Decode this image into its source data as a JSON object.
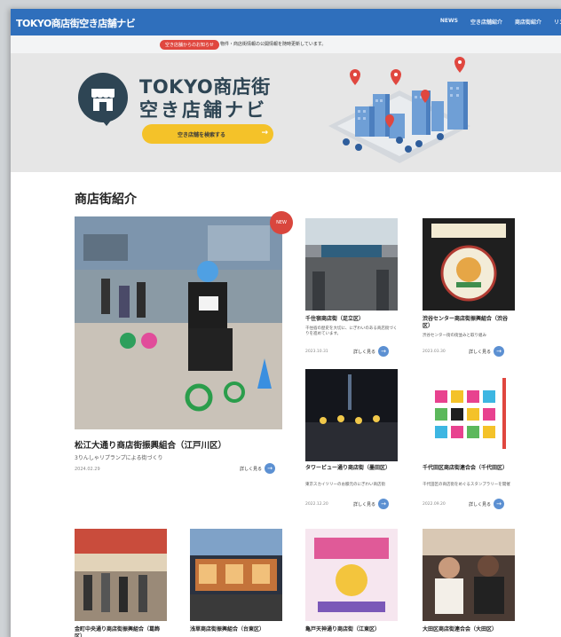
{
  "header": {
    "logo": "TOKYO商店街空き店舗ナビ",
    "nav": [
      "NEWS",
      "空き店舗紹介",
      "商店街紹介",
      "リン"
    ]
  },
  "notice": {
    "badge": "空き店舗からのお知らせ",
    "text": "物件・商店街情報の公開情報を随時更新しています。"
  },
  "hero": {
    "title_line1": "TOKYO商店街",
    "title_line2": "空き店舗ナビ",
    "button_label": "空き店舗を検索する",
    "button_arrow": "→"
  },
  "section": {
    "title": "商店街紹介"
  },
  "featured": {
    "new_badge": "NEW",
    "title": "松江大通り商店街振興組合（江戸川区）",
    "subtitle": "3りんしゃリプランプによる街づくり",
    "date": "2024.02.29",
    "more_label": "詳しく見る"
  },
  "cards": [
    {
      "title": "千住宿商店街（足立区）",
      "desc": "千住宿の歴史を大切に、にぎわいのある商店街づくりを進めています。",
      "date": "2023.10.31",
      "more_label": "詳しく見る"
    },
    {
      "title": "渋谷センター商店街振興組合（渋谷区）",
      "desc": "渋谷センター街の街並みと取り組み",
      "date": "2023.03.30",
      "more_label": "詳しく見る"
    },
    {
      "title": "タワービュー通り商店街（墨田区）",
      "desc": "東京スカイツリーのお膝元のにぎわい商店街",
      "date": "2022.12.20",
      "more_label": "詳しく見る"
    },
    {
      "title": "千代田区商店街連合会（千代田区）",
      "desc": "千代田区の商店街をめぐるスタンプラリーを開催",
      "date": "2022.09.20",
      "more_label": "詳しく見る"
    }
  ],
  "bottom_cards": [
    {
      "title": "金町中央通り商店街振興組合（葛飾区）"
    },
    {
      "title": "浅草商店街振興組合（台東区）"
    },
    {
      "title": "亀戸天神通り商店街（江東区）"
    },
    {
      "title": "大田区商店街連合会（大田区）"
    }
  ],
  "colors": {
    "nav_blue": "#2f6fbc",
    "brand_dark": "#2e4554",
    "button_yellow": "#f4c229",
    "accent_red": "#d9463d",
    "link_blue": "#5c90d2"
  }
}
